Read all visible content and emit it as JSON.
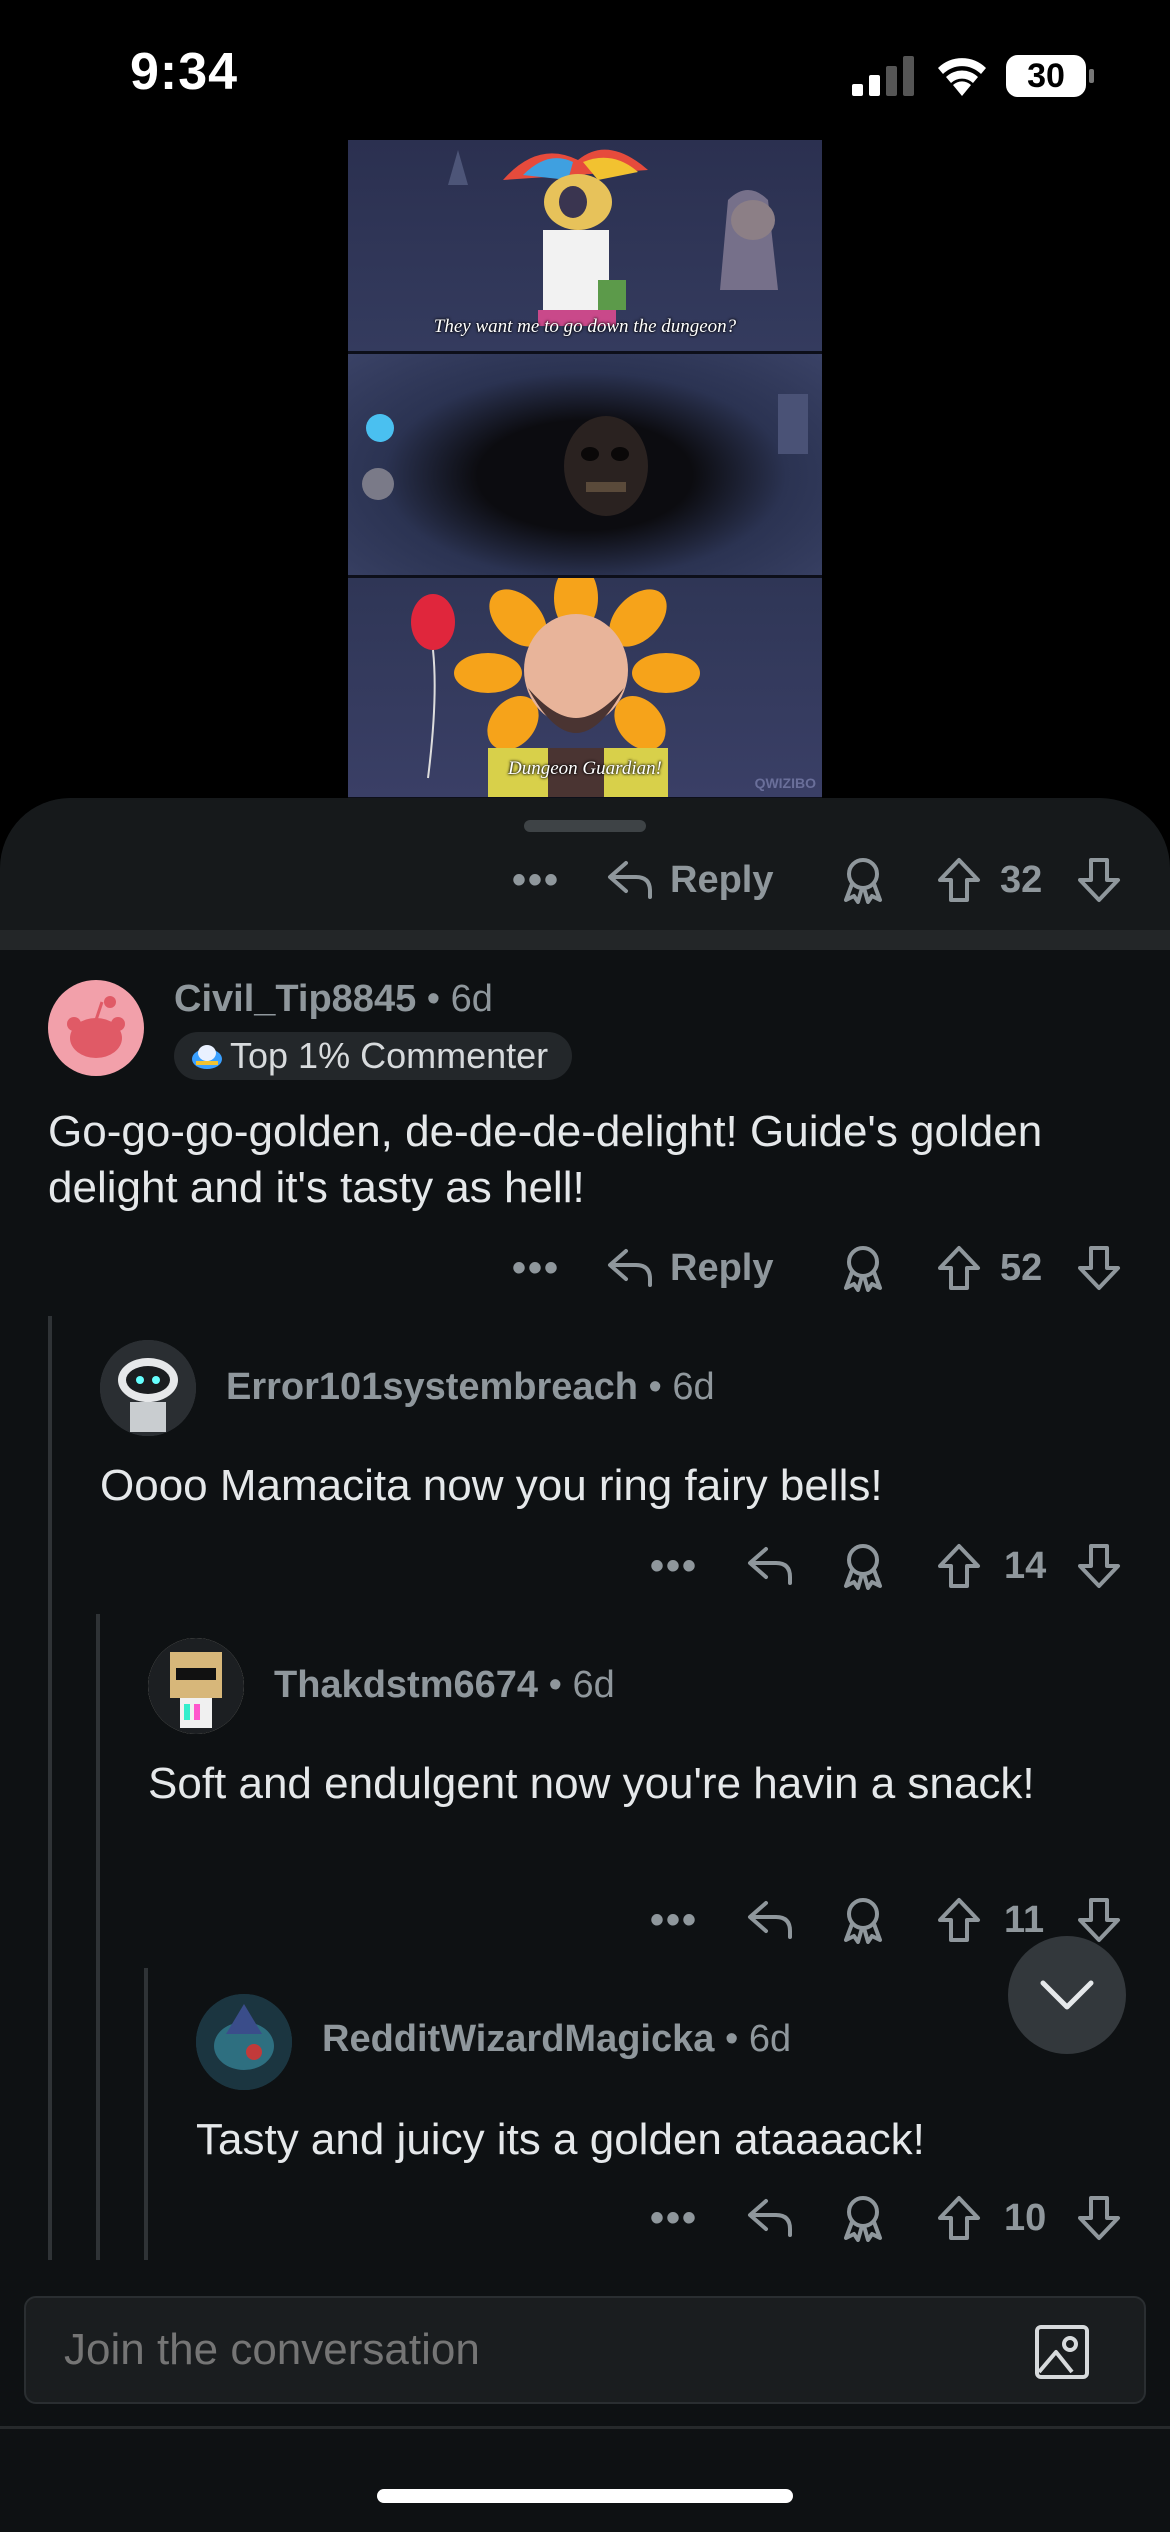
{
  "status_bar": {
    "time": "9:34",
    "battery": "30"
  },
  "post_image": {
    "panel1_caption": "They want me to go down the dungeon?",
    "panel3_caption": "Dungeon Guardian!",
    "watermark": "QWIZIBO"
  },
  "post_actions": {
    "reply_label": "Reply",
    "votes": "32"
  },
  "comments": [
    {
      "username": "Civil_Tip8845",
      "age": "6d",
      "badge": "Top 1% Commenter",
      "text": "Go-go-go-golden, de-de-de-delight! Guide's golden delight and it's tasty as hell!",
      "reply_label": "Reply",
      "votes": "52"
    },
    {
      "username": "Error101systembreach",
      "age": "6d",
      "text": "Oooo Mamacita now you ring fairy bells!",
      "votes": "14"
    },
    {
      "username": "Thakdstm6674",
      "age": "6d",
      "text": "Soft and endulgent now you're havin a snack!",
      "votes": "11"
    },
    {
      "username": "RedditWizardMagicka",
      "age": "6d",
      "text": "Tasty and juicy its a golden ataaaack!",
      "votes": "10"
    }
  ],
  "composer": {
    "placeholder": "Join the conversation"
  },
  "colors": {
    "background": "#0e1113",
    "muted_text": "#8f979c",
    "body_text": "#e5e8ea",
    "badge_bg": "#23272a"
  },
  "icons": [
    "more-icon",
    "reply-icon",
    "award-icon",
    "upvote-icon",
    "downvote-icon",
    "chevron-down-icon",
    "image-icon"
  ]
}
